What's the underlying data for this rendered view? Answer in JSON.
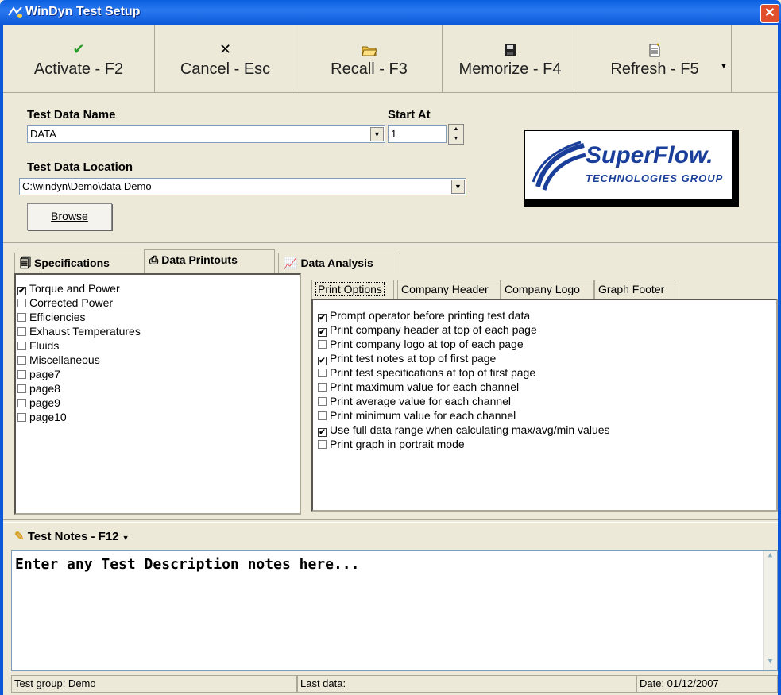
{
  "window": {
    "title": "WinDyn Test Setup"
  },
  "toolbar": {
    "buttons": [
      {
        "label": "Activate - F2",
        "icon": "checkmark-icon",
        "glyph": "✔",
        "color": "#2a9a2a"
      },
      {
        "label": "Cancel - Esc",
        "icon": "close-icon",
        "glyph": "✕",
        "color": "#333333"
      },
      {
        "label": "Recall - F3",
        "icon": "open-folder-icon",
        "glyph": "🗁",
        "color": "#c8a020"
      },
      {
        "label": "Memorize - F4",
        "icon": "floppy-disk-icon",
        "glyph": "▣",
        "color": "#222222"
      },
      {
        "label": "Refresh - F5",
        "icon": "new-document-icon",
        "glyph": "🗎",
        "color": "#333333"
      }
    ]
  },
  "form": {
    "test_data_name_label": "Test Data Name",
    "test_data_name_value": "DATA",
    "start_at_label": "Start At",
    "start_at_value": "1",
    "location_label": "Test Data Location",
    "location_value": "C:\\windyn\\Demo\\data Demo",
    "browse_label": "Browse"
  },
  "logo": {
    "brand": "SuperFlow.",
    "sub": "TECHNOLOGIES GROUP",
    "color": "#1a3f9a"
  },
  "tabs": [
    {
      "label": "Specifications",
      "icon": "document-icon"
    },
    {
      "label": "Data Printouts",
      "icon": "printer-icon",
      "active": true
    },
    {
      "label": "Data Analysis",
      "icon": "chart-icon"
    }
  ],
  "printout_pages": [
    {
      "label": "Torque and Power",
      "checked": true
    },
    {
      "label": "Corrected Power",
      "checked": false
    },
    {
      "label": "Efficiencies",
      "checked": false
    },
    {
      "label": "Exhaust Temperatures",
      "checked": false
    },
    {
      "label": "Fluids",
      "checked": false
    },
    {
      "label": "Miscellaneous",
      "checked": false
    },
    {
      "label": "page7",
      "checked": false
    },
    {
      "label": "page8",
      "checked": false
    },
    {
      "label": "page9",
      "checked": false
    },
    {
      "label": "page10",
      "checked": false
    }
  ],
  "subtabs": [
    {
      "label": "Print Options",
      "active": true
    },
    {
      "label": "Company Header"
    },
    {
      "label": "Company Logo"
    },
    {
      "label": "Graph Footer"
    }
  ],
  "print_options": [
    {
      "label": "Prompt operator before printing test data",
      "checked": true
    },
    {
      "label": "Print company header at top of each page",
      "checked": true
    },
    {
      "label": "Print company logo at top of each page",
      "checked": false
    },
    {
      "label": "Print test notes at top of first page",
      "checked": true
    },
    {
      "label": "Print test specifications at top of first page",
      "checked": false
    },
    {
      "label": "Print maximum value for each channel",
      "checked": false
    },
    {
      "label": "Print average value for each channel",
      "checked": false
    },
    {
      "label": "Print minimum value for each channel",
      "checked": false
    },
    {
      "label": "Use full data range when calculating max/avg/min values",
      "checked": true
    },
    {
      "label": "Print graph in portrait mode",
      "checked": false
    }
  ],
  "notes": {
    "header": "Test Notes - F12",
    "text": "Enter any Test Description notes here..."
  },
  "status": {
    "group": "Test group: Demo",
    "last": "Last data:",
    "date": "Date: 01/12/2007"
  }
}
